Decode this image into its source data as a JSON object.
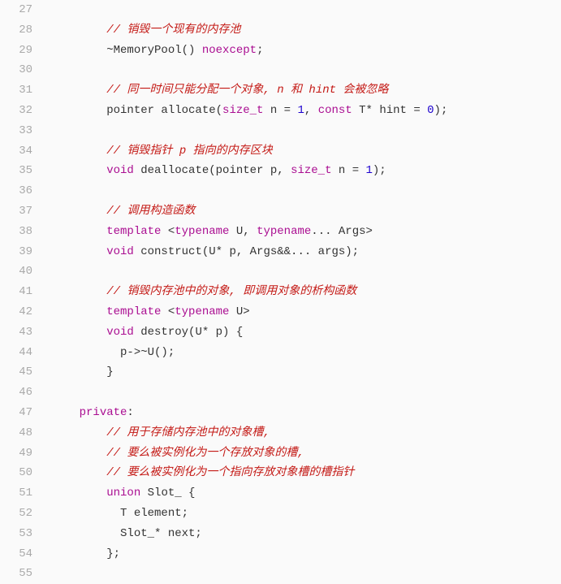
{
  "editor": {
    "startLine": 27,
    "lines": [
      {
        "num": 27,
        "segments": [
          {
            "t": "plain",
            "v": ""
          }
        ]
      },
      {
        "num": 28,
        "segments": [
          {
            "t": "indent",
            "v": "        "
          },
          {
            "t": "comment",
            "v": "// 销毁一个现有的内存池"
          }
        ]
      },
      {
        "num": 29,
        "segments": [
          {
            "t": "indent",
            "v": "        "
          },
          {
            "t": "plain",
            "v": "~MemoryPool() "
          },
          {
            "t": "keyword",
            "v": "noexcept"
          },
          {
            "t": "plain",
            "v": ";"
          }
        ]
      },
      {
        "num": 30,
        "segments": [
          {
            "t": "plain",
            "v": ""
          }
        ]
      },
      {
        "num": 31,
        "segments": [
          {
            "t": "indent",
            "v": "        "
          },
          {
            "t": "comment",
            "v": "// 同一时间只能分配一个对象, n 和 hint 会被忽略"
          }
        ]
      },
      {
        "num": 32,
        "segments": [
          {
            "t": "indent",
            "v": "        "
          },
          {
            "t": "plain",
            "v": "pointer allocate("
          },
          {
            "t": "keyword",
            "v": "size_t"
          },
          {
            "t": "plain",
            "v": " n = "
          },
          {
            "t": "num",
            "v": "1"
          },
          {
            "t": "plain",
            "v": ", "
          },
          {
            "t": "keyword",
            "v": "const"
          },
          {
            "t": "plain",
            "v": " T* hint = "
          },
          {
            "t": "num",
            "v": "0"
          },
          {
            "t": "plain",
            "v": ");"
          }
        ]
      },
      {
        "num": 33,
        "segments": [
          {
            "t": "plain",
            "v": ""
          }
        ]
      },
      {
        "num": 34,
        "segments": [
          {
            "t": "indent",
            "v": "        "
          },
          {
            "t": "comment",
            "v": "// 销毁指针 p 指向的内存区块"
          }
        ]
      },
      {
        "num": 35,
        "segments": [
          {
            "t": "indent",
            "v": "        "
          },
          {
            "t": "keyword",
            "v": "void"
          },
          {
            "t": "plain",
            "v": " deallocate(pointer p, "
          },
          {
            "t": "keyword",
            "v": "size_t"
          },
          {
            "t": "plain",
            "v": " n = "
          },
          {
            "t": "num",
            "v": "1"
          },
          {
            "t": "plain",
            "v": ");"
          }
        ]
      },
      {
        "num": 36,
        "segments": [
          {
            "t": "plain",
            "v": ""
          }
        ]
      },
      {
        "num": 37,
        "segments": [
          {
            "t": "indent",
            "v": "        "
          },
          {
            "t": "comment",
            "v": "// 调用构造函数"
          }
        ]
      },
      {
        "num": 38,
        "segments": [
          {
            "t": "indent",
            "v": "        "
          },
          {
            "t": "keyword",
            "v": "template"
          },
          {
            "t": "plain",
            "v": " <"
          },
          {
            "t": "keyword",
            "v": "typename"
          },
          {
            "t": "plain",
            "v": " U, "
          },
          {
            "t": "keyword",
            "v": "typename"
          },
          {
            "t": "plain",
            "v": "... Args>"
          }
        ]
      },
      {
        "num": 39,
        "segments": [
          {
            "t": "indent",
            "v": "        "
          },
          {
            "t": "keyword",
            "v": "void"
          },
          {
            "t": "plain",
            "v": " construct(U* p, Args&&... args);"
          }
        ]
      },
      {
        "num": 40,
        "segments": [
          {
            "t": "plain",
            "v": ""
          }
        ]
      },
      {
        "num": 41,
        "segments": [
          {
            "t": "indent",
            "v": "        "
          },
          {
            "t": "comment",
            "v": "// 销毁内存池中的对象, 即调用对象的析构函数"
          }
        ]
      },
      {
        "num": 42,
        "segments": [
          {
            "t": "indent",
            "v": "        "
          },
          {
            "t": "keyword",
            "v": "template"
          },
          {
            "t": "plain",
            "v": " <"
          },
          {
            "t": "keyword",
            "v": "typename"
          },
          {
            "t": "plain",
            "v": " U>"
          }
        ]
      },
      {
        "num": 43,
        "segments": [
          {
            "t": "indent",
            "v": "        "
          },
          {
            "t": "keyword",
            "v": "void"
          },
          {
            "t": "plain",
            "v": " destroy(U* p) {"
          }
        ]
      },
      {
        "num": 44,
        "segments": [
          {
            "t": "indent",
            "v": "          "
          },
          {
            "t": "plain",
            "v": "p->~U();"
          }
        ]
      },
      {
        "num": 45,
        "segments": [
          {
            "t": "indent",
            "v": "        "
          },
          {
            "t": "plain",
            "v": "}"
          }
        ]
      },
      {
        "num": 46,
        "segments": [
          {
            "t": "plain",
            "v": ""
          }
        ]
      },
      {
        "num": 47,
        "segments": [
          {
            "t": "indent",
            "v": "    "
          },
          {
            "t": "keyword",
            "v": "private"
          },
          {
            "t": "plain",
            "v": ":"
          }
        ]
      },
      {
        "num": 48,
        "segments": [
          {
            "t": "indent",
            "v": "        "
          },
          {
            "t": "comment",
            "v": "// 用于存储内存池中的对象槽,"
          }
        ]
      },
      {
        "num": 49,
        "segments": [
          {
            "t": "indent",
            "v": "        "
          },
          {
            "t": "comment",
            "v": "// 要么被实例化为一个存放对象的槽,"
          }
        ]
      },
      {
        "num": 50,
        "segments": [
          {
            "t": "indent",
            "v": "        "
          },
          {
            "t": "comment",
            "v": "// 要么被实例化为一个指向存放对象槽的槽指针"
          }
        ]
      },
      {
        "num": 51,
        "segments": [
          {
            "t": "indent",
            "v": "        "
          },
          {
            "t": "keyword",
            "v": "union"
          },
          {
            "t": "plain",
            "v": " Slot_ {"
          }
        ]
      },
      {
        "num": 52,
        "segments": [
          {
            "t": "indent",
            "v": "          "
          },
          {
            "t": "plain",
            "v": "T element;"
          }
        ]
      },
      {
        "num": 53,
        "segments": [
          {
            "t": "indent",
            "v": "          "
          },
          {
            "t": "plain",
            "v": "Slot_* next;"
          }
        ]
      },
      {
        "num": 54,
        "segments": [
          {
            "t": "indent",
            "v": "        "
          },
          {
            "t": "plain",
            "v": "};"
          }
        ]
      },
      {
        "num": 55,
        "segments": [
          {
            "t": "plain",
            "v": ""
          }
        ]
      }
    ]
  }
}
